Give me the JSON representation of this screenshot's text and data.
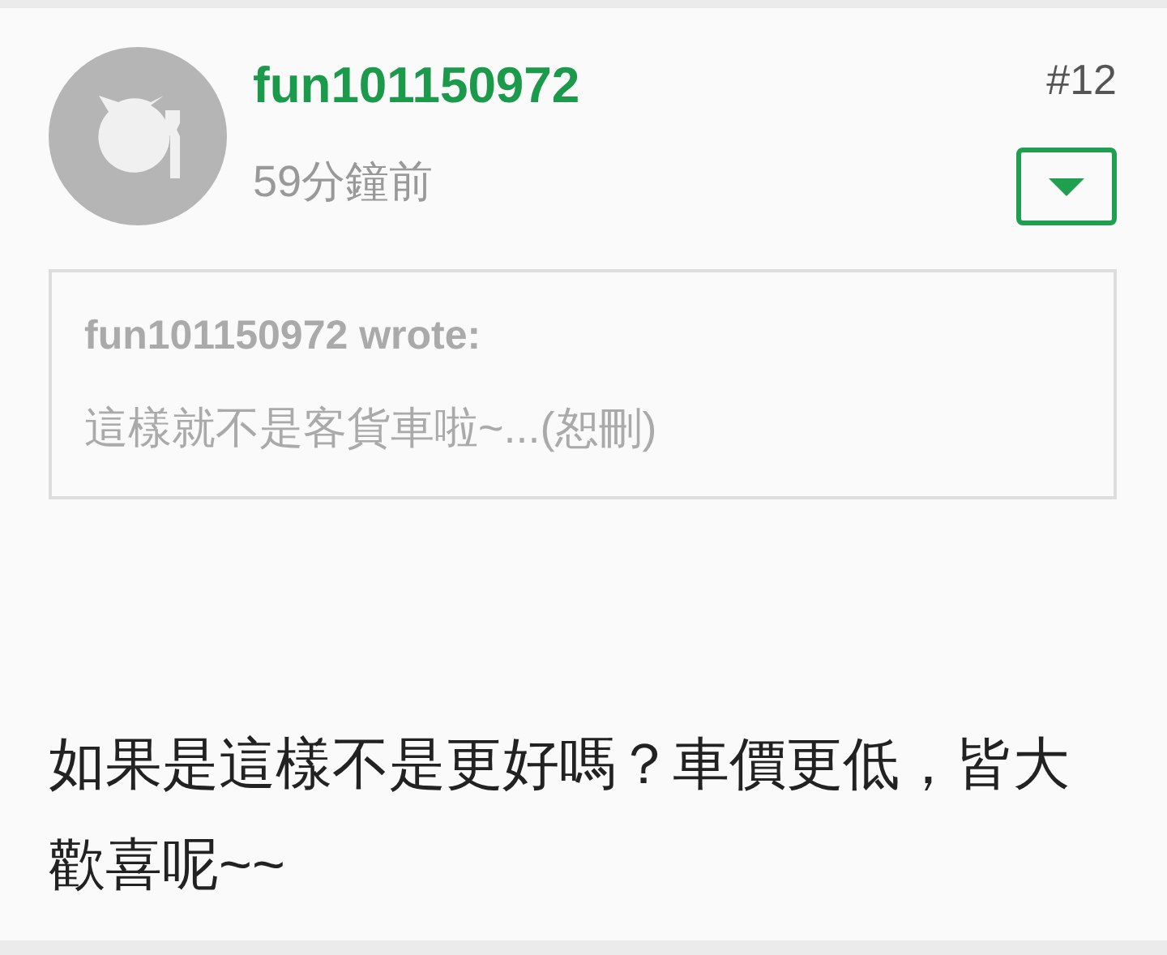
{
  "post": {
    "author": "fun101150972",
    "time": "59分鐘前",
    "number": "#12",
    "menu_expanded": false,
    "quote": {
      "author_line": "fun101150972 wrote:",
      "text": "這樣就不是客貨車啦~...(恕刪)"
    },
    "body": "如果是這樣不是更好嗎？車價更低，皆大歡喜呢~~"
  }
}
